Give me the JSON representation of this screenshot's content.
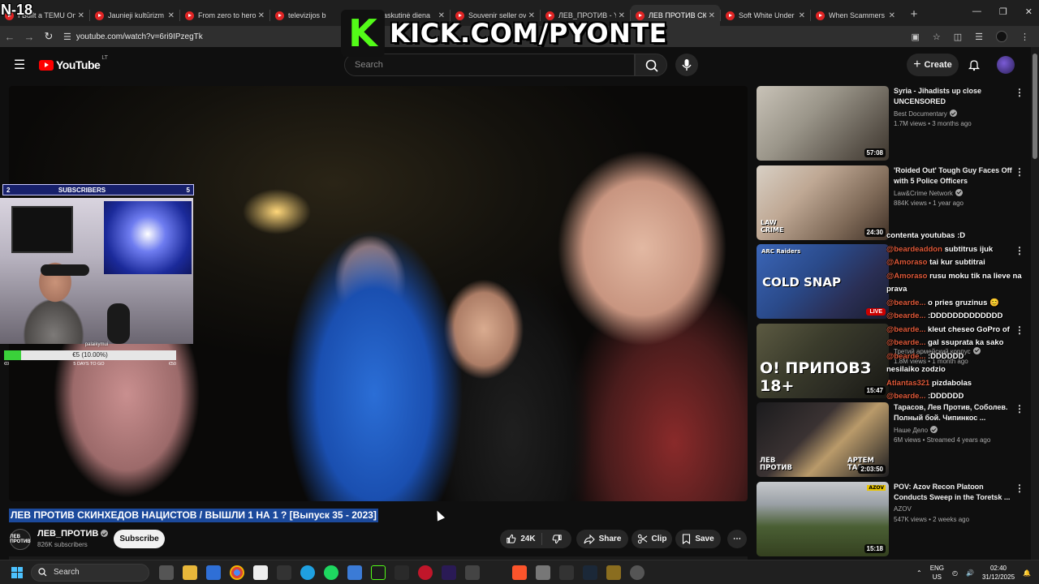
{
  "overlay": {
    "age_badge": "N-18",
    "kick_letter": "K",
    "kick_url": "KICK.COM/PYONTE"
  },
  "browser": {
    "tabs": [
      {
        "label": "I Built a TEMU Onl"
      },
      {
        "label": "Jaunieji kultūrizm"
      },
      {
        "label": "From zero to hero"
      },
      {
        "label": "televizijos b"
      },
      {
        "label": "Paskutinė diena"
      },
      {
        "label": "Souvenir seller ov"
      },
      {
        "label": "ЛЕВ_ПРОТИВ - Yo"
      },
      {
        "label": "ЛЕВ ПРОТИВ СКИ"
      },
      {
        "label": "Soft White Under"
      },
      {
        "label": "When Scammers"
      }
    ],
    "new_tab": "+",
    "url": "youtube.com/watch?v=6ri9IPzegTk"
  },
  "youtube": {
    "logo": "YouTube",
    "logo_region": "LT",
    "search_placeholder": "Search",
    "create_label": "Create"
  },
  "stream": {
    "subs_left": "2",
    "subs_label": "SUBSCRIBERS",
    "subs_right": "5",
    "streamer_name": "palaikymui",
    "goal_text": "€5 (10.00%)",
    "goal_progress": 0.1,
    "goal_start": "€0",
    "goal_days": "5 DAYS TO GO",
    "goal_end": "€50"
  },
  "video": {
    "title": "ЛЕВ ПРОТИВ СКИНХЕДОВ НАЦИСТОВ / ВЫШЛИ 1 НА 1 ? [Выпуск 35 - 2023]",
    "channel": "ЛЕВ_ПРОТИВ",
    "channel_avatar_text": "ЛЕВ ПРОТИВ",
    "subscribers": "826K subscribers",
    "subscribe_label": "Subscribe",
    "likes": "24K",
    "share_label": "Share",
    "clip_label": "Clip",
    "save_label": "Save"
  },
  "recommendations": [
    {
      "title": "Syria - Jihadists up close UNCENSORED",
      "channel": "Best Documentary",
      "verified": true,
      "meta": "1.7M views • 3 months ago",
      "duration": "57:08"
    },
    {
      "title": "'Roided Out' Tough Guy Faces Off with 5 Police Officers",
      "channel": "Law&Crime Network",
      "verified": true,
      "meta": "884K views • 1 year ago",
      "duration": "24:30",
      "thumb_text": "LAW CRIME"
    },
    {
      "title": "",
      "channel": "",
      "verified": false,
      "meta": "",
      "live": "LIVE",
      "thumb_text": "COLD SNAP",
      "thumb_badge": "ARC Raiders"
    },
    {
      "title": "",
      "channel": "Третий армейский корпус",
      "verified": true,
      "meta": "1.8M views • 1 month ago",
      "duration": "15:47",
      "thumb_text": "О! ПРИПОВЗ 18+"
    },
    {
      "title": "Тарасов, Лев Против, Соболев. Полный бой. Чипинкос ...",
      "channel": "Наше Дело",
      "verified": true,
      "meta": "6M views • Streamed 4 years ago",
      "duration": "2:03:50",
      "thumb_text_left": "ЛЕВ ПРОТИВ",
      "thumb_text_right": "АРТЕМ ТАР"
    },
    {
      "title": "POV: Azov Recon Platoon Conducts Sweep in the Toretsk ...",
      "channel": "AZOV",
      "verified": false,
      "meta": "547K views • 2 weeks ago",
      "duration": "15:18",
      "thumb_badge": "AZOV"
    }
  ],
  "chat": [
    {
      "user": "",
      "text": "contenta youtubas :D"
    },
    {
      "user": "@beardeaddon",
      "text": "subtitrus ijuk"
    },
    {
      "user": "@Amoraso",
      "text": "tai kur subtitrai"
    },
    {
      "user": "@Amoraso",
      "text": "rusu moku tik na lieve na prava"
    },
    {
      "user": "@bearde...",
      "text": "o pries gruzinus 😊"
    },
    {
      "user": "@bearde...",
      "text": ":DDDDDDDDDDDDD"
    },
    {
      "user": "@bearde...",
      "text": "kleut cheseo GoPro of"
    },
    {
      "user": "@bearde...",
      "text": "gal ssuprata ka sako"
    },
    {
      "user": "@bearde...",
      "text": ":DDDDDD"
    },
    {
      "user": "",
      "text": "nesilaiko zodzio"
    },
    {
      "user": "Atlantas321",
      "text": "pizdabolas"
    },
    {
      "user": "@bearde...",
      "text": ":DDDDDD"
    }
  ],
  "taskbar": {
    "search_label": "Search",
    "lang_top": "ENG",
    "lang_bottom": "US",
    "time": "02:40",
    "date": "31/12/2025"
  },
  "colors": {
    "yt_red": "#ff0000",
    "kick_green": "#53fc18",
    "title_highlight": "#1c4a9c",
    "goal_fill": "#3ad13a",
    "subs_bar": "#17206b"
  }
}
